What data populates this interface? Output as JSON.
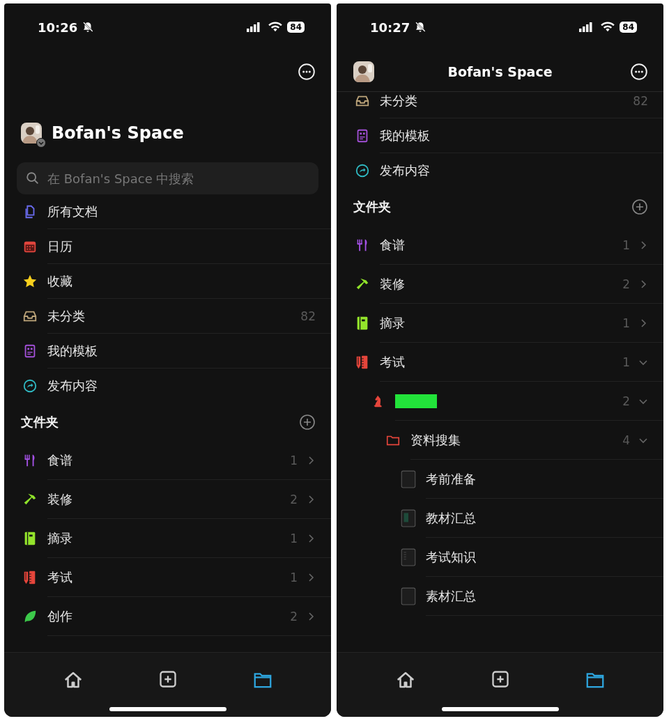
{
  "screens": [
    {
      "status_bar": {
        "time": "10:26",
        "battery": "84"
      },
      "header": {
        "kind": "large",
        "title": "Bofan's Space"
      },
      "search": {
        "placeholder": "在 Bofan's Space 中搜索"
      },
      "nav_items": [
        {
          "kind": "documents",
          "label": "所有文档"
        },
        {
          "kind": "calendar",
          "label": "日历"
        },
        {
          "kind": "star",
          "label": "收藏"
        },
        {
          "kind": "inbox",
          "label": "未分类",
          "count": "82"
        },
        {
          "kind": "template",
          "label": "我的模板"
        },
        {
          "kind": "share",
          "label": "发布内容"
        }
      ],
      "folders_title": "文件夹",
      "folders": [
        {
          "kind": "utensils",
          "label": "食谱",
          "count": "1",
          "expanded": false
        },
        {
          "kind": "hammer",
          "label": "装修",
          "count": "2",
          "expanded": false
        },
        {
          "kind": "notebook",
          "label": "摘录",
          "count": "1",
          "expanded": false
        },
        {
          "kind": "pencil",
          "label": "考试",
          "count": "1",
          "expanded": false
        },
        {
          "kind": "leaf",
          "label": "创作",
          "count": "2",
          "expanded": false
        }
      ],
      "tab_bar": [
        {
          "kind": "home",
          "selected": false
        },
        {
          "kind": "add",
          "selected": false
        },
        {
          "kind": "folder",
          "selected": true
        }
      ]
    },
    {
      "status_bar": {
        "time": "10:27",
        "battery": "84"
      },
      "header": {
        "kind": "compact",
        "title": "Bofan's Space"
      },
      "nav_items": [
        {
          "kind": "inbox",
          "label": "未分类",
          "count": "82"
        },
        {
          "kind": "template",
          "label": "我的模板"
        },
        {
          "kind": "share",
          "label": "发布内容"
        }
      ],
      "folders_title": "文件夹",
      "folders": [
        {
          "kind": "utensils",
          "label": "食谱",
          "count": "1",
          "expanded": false
        },
        {
          "kind": "hammer",
          "label": "装修",
          "count": "2",
          "expanded": false
        },
        {
          "kind": "notebook",
          "label": "摘录",
          "count": "1",
          "expanded": false
        },
        {
          "kind": "pencil",
          "label": "考试",
          "count": "1",
          "expanded": true,
          "children": [
            {
              "kind": "knight",
              "count": "2",
              "expanded": true,
              "children": [
                {
                  "kind": "folder",
                  "label": "资料搜集",
                  "count": "4",
                  "expanded": true,
                  "children": [
                    {
                      "kind": "doc",
                      "label": "考前准备"
                    },
                    {
                      "kind": "docgreen",
                      "label": "教材汇总"
                    },
                    {
                      "kind": "doclines",
                      "label": "考试知识"
                    },
                    {
                      "kind": "doc",
                      "label": "素材汇总"
                    }
                  ]
                }
              ]
            }
          ]
        }
      ],
      "tab_bar": [
        {
          "kind": "home",
          "selected": false
        },
        {
          "kind": "add",
          "selected": false
        },
        {
          "kind": "folder",
          "selected": true
        }
      ]
    }
  ]
}
